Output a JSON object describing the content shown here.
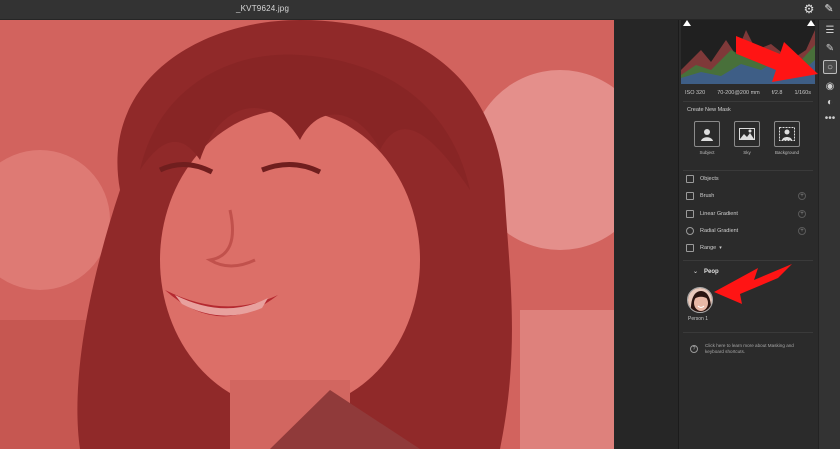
{
  "window": {
    "title": "_KVT9624.jpg"
  },
  "topbar_icons": [
    "gear-icon",
    "pen-icon"
  ],
  "camera_info": {
    "iso": "ISO 320",
    "lens": "70-200@200 mm",
    "aperture": "f/2.8",
    "shutter": "1/160s"
  },
  "masking": {
    "create_label": "Create New Mask",
    "quick_masks": [
      {
        "label": "Subject",
        "icon": "subject-icon"
      },
      {
        "label": "Sky",
        "icon": "sky-icon"
      },
      {
        "label": "Background",
        "icon": "background-icon"
      }
    ],
    "tools": [
      {
        "label": "Objects",
        "icon": "objects-icon"
      },
      {
        "label": "Brush",
        "icon": "brush-icon"
      },
      {
        "label": "Linear Gradient",
        "icon": "linear-gradient-icon"
      },
      {
        "label": "Radial Gradient",
        "icon": "radial-gradient-icon"
      },
      {
        "label": "Range",
        "icon": "range-icon"
      }
    ],
    "people_heading": "Peop",
    "person_label": "Person 1",
    "help_text": "Click here to learn more about Masking and keyboard shortcuts."
  },
  "toolstrip": [
    "edit-icon",
    "brush-icon",
    "masking-icon",
    "redeye-icon",
    "presets-icon",
    "more-icon"
  ],
  "colors": {
    "accent_red": "#ff1414",
    "mask_overlay": "#d83c3c"
  }
}
